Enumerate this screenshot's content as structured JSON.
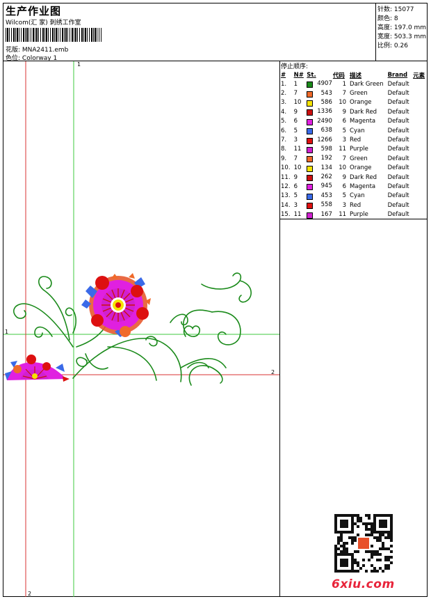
{
  "header": {
    "title": "生产作业图",
    "subtitle": "Wilcom(汇 家) 刺绣工作室",
    "design_label": "花版: ",
    "design_value": "MNA2411.emb",
    "colorway_label": "色位: ",
    "colorway_value": "Colorway 1"
  },
  "stats": [
    {
      "label": "针数: ",
      "value": "15077"
    },
    {
      "label": "颜色: ",
      "value": "8"
    },
    {
      "label": "高度: ",
      "value": "197.0 mm"
    },
    {
      "label": "宽度: ",
      "value": "503.3 mm"
    },
    {
      "label": "比例: ",
      "value": "0.26"
    }
  ],
  "guides": {
    "top_green": "1",
    "left_green": "1",
    "right_red": "2",
    "bottom_red": "2"
  },
  "stop_sequence": {
    "title": "停止顺序:",
    "columns": [
      "#",
      "N#",
      "St.",
      "代码",
      "描述",
      "Brand",
      "元素"
    ],
    "rows": [
      {
        "idx": "1.",
        "n": "1",
        "color": "#1a8a1a",
        "st": "4907",
        "code": "1",
        "desc": "Dark Green",
        "brand": "Default"
      },
      {
        "idx": "2.",
        "n": "7",
        "color": "#f06a2a",
        "st": "543",
        "code": "7",
        "desc": "Green",
        "brand": "Default"
      },
      {
        "idx": "3.",
        "n": "10",
        "color": "#f5e400",
        "st": "586",
        "code": "10",
        "desc": "Orange",
        "brand": "Default"
      },
      {
        "idx": "4.",
        "n": "9",
        "color": "#cc1010",
        "st": "1336",
        "code": "9",
        "desc": "Dark Red",
        "brand": "Default"
      },
      {
        "idx": "5.",
        "n": "6",
        "color": "#e020e0",
        "st": "2490",
        "code": "6",
        "desc": "Magenta",
        "brand": "Default"
      },
      {
        "idx": "6.",
        "n": "5",
        "color": "#3a6ae8",
        "st": "638",
        "code": "5",
        "desc": "Cyan",
        "brand": "Default"
      },
      {
        "idx": "7.",
        "n": "3",
        "color": "#dd1010",
        "st": "1266",
        "code": "3",
        "desc": "Red",
        "brand": "Default"
      },
      {
        "idx": "8.",
        "n": "11",
        "color": "#d020d0",
        "st": "598",
        "code": "11",
        "desc": "Purple",
        "brand": "Default"
      },
      {
        "idx": "9.",
        "n": "7",
        "color": "#f06a2a",
        "st": "192",
        "code": "7",
        "desc": "Green",
        "brand": "Default"
      },
      {
        "idx": "10.",
        "n": "10",
        "color": "#f5e400",
        "st": "134",
        "code": "10",
        "desc": "Orange",
        "brand": "Default"
      },
      {
        "idx": "11.",
        "n": "9",
        "color": "#cc1010",
        "st": "262",
        "code": "9",
        "desc": "Dark Red",
        "brand": "Default"
      },
      {
        "idx": "12.",
        "n": "6",
        "color": "#e020e0",
        "st": "945",
        "code": "6",
        "desc": "Magenta",
        "brand": "Default"
      },
      {
        "idx": "13.",
        "n": "5",
        "color": "#3a6ae8",
        "st": "453",
        "code": "5",
        "desc": "Cyan",
        "brand": "Default"
      },
      {
        "idx": "14.",
        "n": "3",
        "color": "#dd1010",
        "st": "558",
        "code": "3",
        "desc": "Red",
        "brand": "Default"
      },
      {
        "idx": "15.",
        "n": "11",
        "color": "#d020d0",
        "st": "167",
        "code": "11",
        "desc": "Purple",
        "brand": "Default"
      }
    ]
  },
  "logo_text": "6xiu.com",
  "colors": {
    "guide_green": "#3ec93e",
    "guide_red": "#d83030",
    "vine": "#1a8a1a"
  }
}
